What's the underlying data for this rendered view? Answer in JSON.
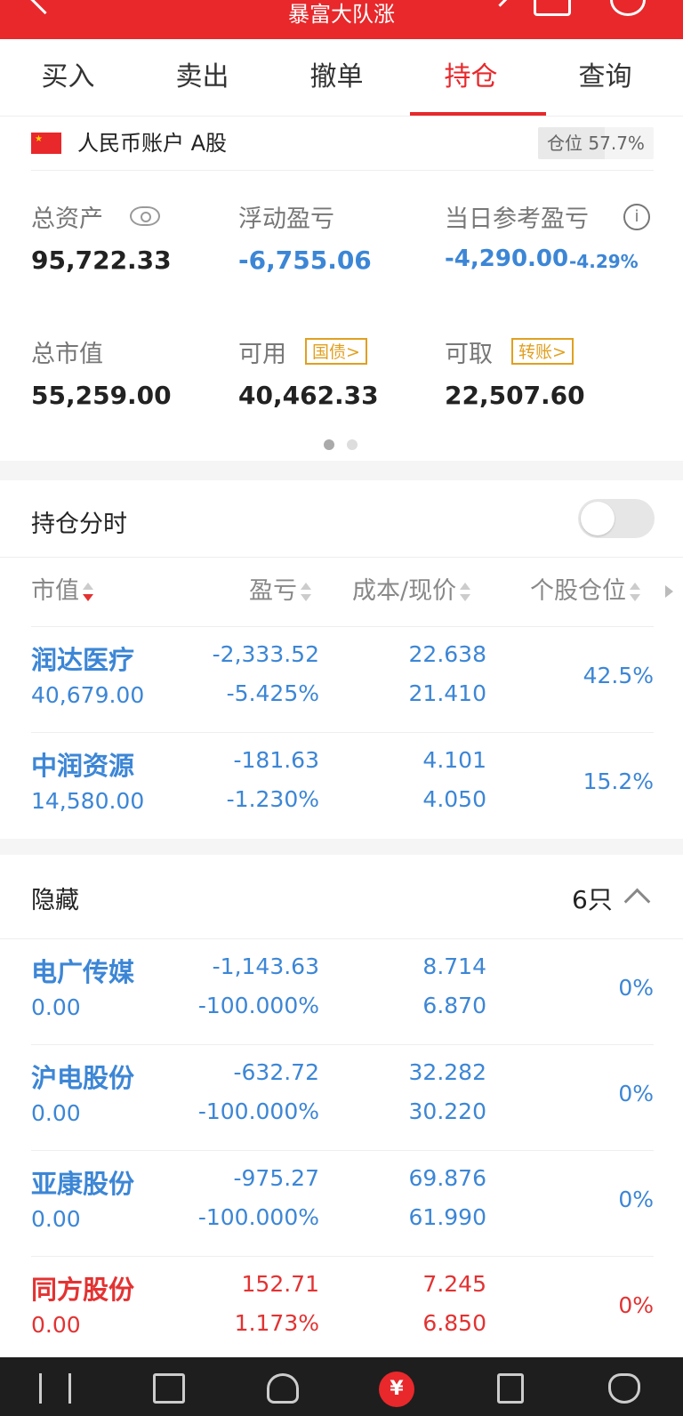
{
  "header": {
    "title": "暴富大队涨"
  },
  "tabs": [
    "买入",
    "卖出",
    "撤单",
    "持仓",
    "查询"
  ],
  "active_tab": 3,
  "account": {
    "name": "人民币账户 A股",
    "position_label": "仓位 57.7%",
    "position_fraction": 0.577
  },
  "summary": {
    "total_assets_label": "总资产",
    "total_assets": "95,722.33",
    "float_pl_label": "浮动盈亏",
    "float_pl": "-6,755.06",
    "day_pl_label": "当日参考盈亏",
    "day_pl": "-4,290.00",
    "day_pl_pct": "-4.29%",
    "market_value_label": "总市值",
    "market_value": "55,259.00",
    "available_label": "可用",
    "available_tag": "国债>",
    "available": "40,462.33",
    "withdrawable_label": "可取",
    "withdrawable_tag": "转账>",
    "withdrawable": "22,507.60"
  },
  "timeshare": {
    "label": "持仓分时",
    "enabled": false
  },
  "columns": {
    "market_value": "市值",
    "pl": "盈亏",
    "cost_price": "成本/现价",
    "weight": "个股仓位"
  },
  "holdings": [
    {
      "name": "润达医疗",
      "market_value": "40,679.00",
      "pl": "-2,333.52",
      "pl_pct": "-5.425%",
      "cost": "22.638",
      "price": "21.410",
      "weight": "42.5%",
      "color": "#3c86d6"
    },
    {
      "name": "中润资源",
      "market_value": "14,580.00",
      "pl": "-181.63",
      "pl_pct": "-1.230%",
      "cost": "4.101",
      "price": "4.050",
      "weight": "15.2%",
      "color": "#3c86d6"
    }
  ],
  "hidden": {
    "label": "隐藏",
    "count": "6只",
    "rows": [
      {
        "name": "电广传媒",
        "market_value": "0.00",
        "pl": "-1,143.63",
        "pl_pct": "-100.000%",
        "cost": "8.714",
        "price": "6.870",
        "weight": "0%",
        "color": "#3c86d6"
      },
      {
        "name": "沪电股份",
        "market_value": "0.00",
        "pl": "-632.72",
        "pl_pct": "-100.000%",
        "cost": "32.282",
        "price": "30.220",
        "weight": "0%",
        "color": "#3c86d6"
      },
      {
        "name": "亚康股份",
        "market_value": "0.00",
        "pl": "-975.27",
        "pl_pct": "-100.000%",
        "cost": "69.876",
        "price": "61.990",
        "weight": "0%",
        "color": "#3c86d6"
      },
      {
        "name": "同方股份",
        "market_value": "0.00",
        "pl": "152.71",
        "pl_pct": "1.173%",
        "cost": "7.245",
        "price": "6.850",
        "weight": "0%",
        "color": "#e33232"
      }
    ]
  },
  "bottom_nav": [
    {
      "icon": "candlestick-icon"
    },
    {
      "icon": "chart-icon"
    },
    {
      "icon": "person-icon"
    },
    {
      "icon": "yen-icon",
      "glyph": "¥"
    },
    {
      "icon": "document-icon"
    },
    {
      "icon": "money-bag-icon"
    }
  ]
}
